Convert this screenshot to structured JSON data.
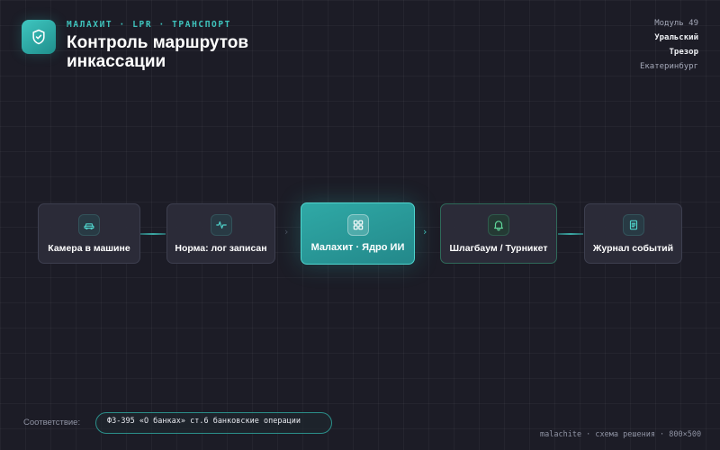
{
  "header": {
    "kicker": "МАЛАХИТ · LPR · ТРАНСПОРТ",
    "title": "Контроль маршрутов инкассации"
  },
  "meta": {
    "line1": "Модуль 49",
    "line2": "Уральский",
    "line3": "Трезор",
    "line4": "Екатеринбург"
  },
  "flow": {
    "nodes": [
      {
        "label": "Камера в машине",
        "icon": "car-icon"
      },
      {
        "label": "Норма: лог записан",
        "icon": "pulse-icon"
      },
      {
        "label": "Малахит · Ядро ИИ",
        "icon": "grid-icon"
      },
      {
        "label": "Шлагбаум / Турникет",
        "icon": "bell-icon"
      },
      {
        "label": "Журнал событий",
        "icon": "document-icon"
      }
    ]
  },
  "footer": {
    "law_label": "Соответствие:",
    "law_text": "ФЗ-395 «О банках» ст.6 банковские операции",
    "caption": "malachite · схема решения · 800×500"
  },
  "colors": {
    "accent": "#3fc4bd",
    "background": "#1c1c26",
    "node_bg": "#2c2d3a",
    "core_node": "#2aa3a1",
    "gate_border": "#2f6a5a"
  }
}
